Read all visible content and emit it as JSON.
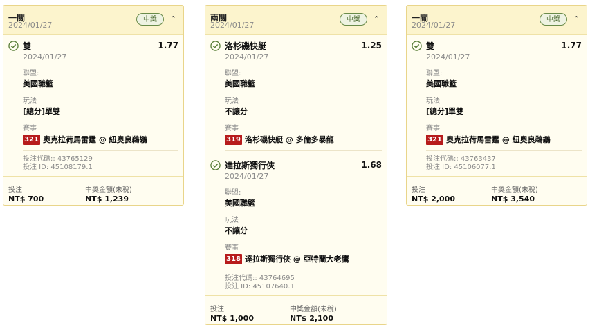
{
  "cards": [
    {
      "title": "一關",
      "date": "2024/01/27",
      "badge": "中獎",
      "legs": [
        {
          "selection": "雙",
          "odds": "1.77",
          "date": "2024/01/27",
          "league_label": "聯盟:",
          "league": "美國職籃",
          "play_label": "玩法",
          "play": "[總分]單雙",
          "event_label": "賽事",
          "event_num": "321",
          "event": "奧克拉荷馬雷霆 @ 紐奧良鵜鶘"
        }
      ],
      "ticket_code": "投注代碼:: 43765129",
      "ticket_id": "投注 ID: 45108179.1",
      "stake_label": "投注",
      "stake": "NT$ 700",
      "payout_label": "中獎金額(未稅)",
      "payout": "NT$ 1,239"
    },
    {
      "title": "兩關",
      "date": "2024/01/27",
      "badge": "中獎",
      "legs": [
        {
          "selection": "洛杉磯快艇",
          "odds": "1.25",
          "date": "2024/01/27",
          "league_label": "聯盟:",
          "league": "美國職籃",
          "play_label": "玩法",
          "play": "不讓分",
          "event_label": "賽事",
          "event_num": "319",
          "event": "洛杉磯快艇 @ 多倫多暴龍"
        },
        {
          "selection": "達拉斯獨行俠",
          "odds": "1.68",
          "date": "2024/01/27",
          "league_label": "聯盟:",
          "league": "美國職籃",
          "play_label": "玩法",
          "play": "不讓分",
          "event_label": "賽事",
          "event_num": "318",
          "event": "達拉斯獨行俠 @ 亞特蘭大老鷹"
        }
      ],
      "ticket_code": "投注代碼:: 43764695",
      "ticket_id": "投注 ID: 45107640.1",
      "stake_label": "投注",
      "stake": "NT$ 1,000",
      "payout_label": "中獎金額(未稅)",
      "payout": "NT$ 2,100"
    },
    {
      "title": "一關",
      "date": "2024/01/27",
      "badge": "中獎",
      "legs": [
        {
          "selection": "雙",
          "odds": "1.77",
          "date": "2024/01/27",
          "league_label": "聯盟:",
          "league": "美國職籃",
          "play_label": "玩法",
          "play": "[總分]單雙",
          "event_label": "賽事",
          "event_num": "321",
          "event": "奧克拉荷馬雷霆 @ 紐奧良鵜鶘"
        }
      ],
      "ticket_code": "投注代碼:: 43763437",
      "ticket_id": "投注 ID: 45106077.1",
      "stake_label": "投注",
      "stake": "NT$ 2,000",
      "payout_label": "中獎金額(未稅)",
      "payout": "NT$ 3,540"
    }
  ],
  "colors": {
    "card_border": "#e9d58a",
    "header_bg": "#fcf4cd",
    "badge_green": "#4e6d33",
    "event_red": "#b71c1c"
  },
  "icons": {
    "won": "check-circle-icon",
    "collapse": "chevron-up-icon"
  }
}
